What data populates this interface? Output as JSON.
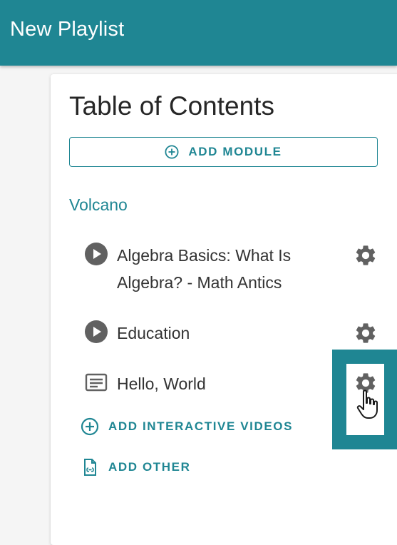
{
  "header": {
    "title": "New Playlist"
  },
  "toc": {
    "title": "Table of Contents",
    "add_module_label": "ADD MODULE"
  },
  "module": {
    "title": "Volcano",
    "items": [
      {
        "label": "Algebra Basics: What Is Algebra? - Math Antics",
        "icon": "play-circle-icon"
      },
      {
        "label": "Education",
        "icon": "play-circle-icon"
      },
      {
        "label": "Hello, World",
        "icon": "text-document-icon"
      }
    ],
    "add_interactive_videos_label": "ADD INTERACTIVE VIDEOS",
    "add_other_label": "ADD OTHER"
  },
  "colors": {
    "brand": "#1f8693",
    "text": "#333333",
    "icon_gray": "#616161"
  }
}
